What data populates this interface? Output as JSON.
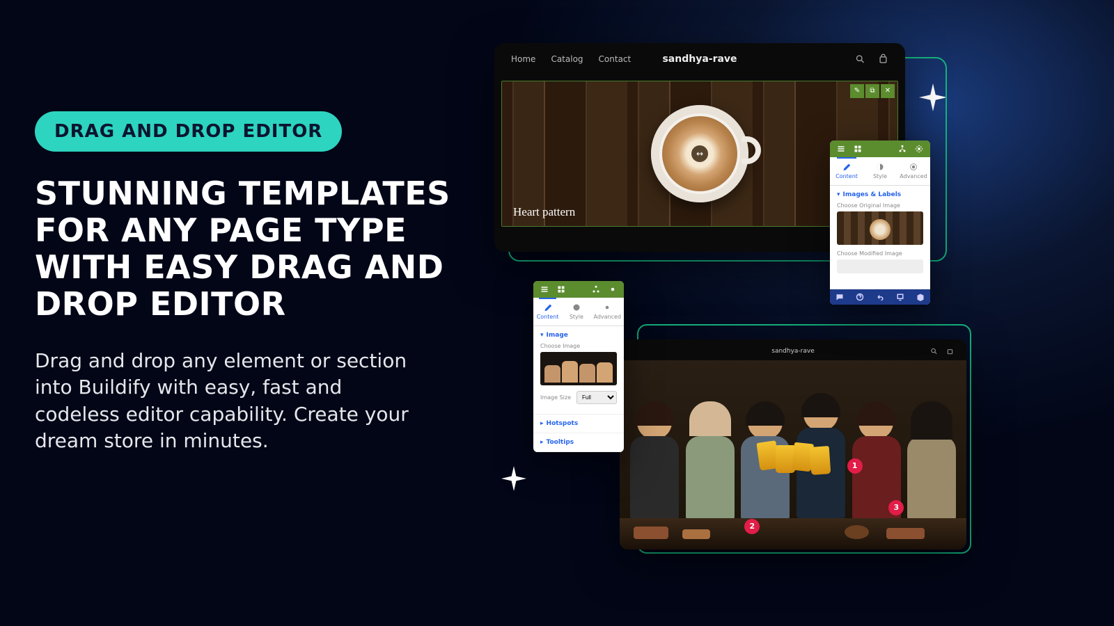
{
  "badge": "DRAG AND DROP EDITOR",
  "headline": "STUNNING TEMPLATES FOR ANY PAGE TYPE WITH EASY DRAG AND DROP EDITOR",
  "body": "Drag and drop any element or section into Buildify with easy, fast and codeless editor capability. Create your dream store in minutes.",
  "preview1": {
    "nav": {
      "home": "Home",
      "catalog": "Catalog",
      "contact": "Contact"
    },
    "brand": "sandhya-rave",
    "caption": "Heart pattern",
    "hotspot": "↔"
  },
  "panelA": {
    "tabs": {
      "content": "Content",
      "style": "Style",
      "advanced": "Advanced"
    },
    "section": "Images & Labels",
    "labels": {
      "orig": "Choose Original Image",
      "mod": "Choose Modified Image"
    }
  },
  "panelB": {
    "tabs": {
      "content": "Content",
      "style": "Style",
      "advanced": "Advanced"
    },
    "sections": {
      "image": "Image",
      "hotspots": "Hotspots",
      "tooltips": "Tooltips"
    },
    "labels": {
      "choose": "Choose Image",
      "size": "Image Size"
    },
    "sizeValue": "Full"
  },
  "preview2": {
    "brand": "sandhya-rave",
    "hotspots": {
      "h1": "1",
      "h2": "2",
      "h3": "3"
    }
  }
}
